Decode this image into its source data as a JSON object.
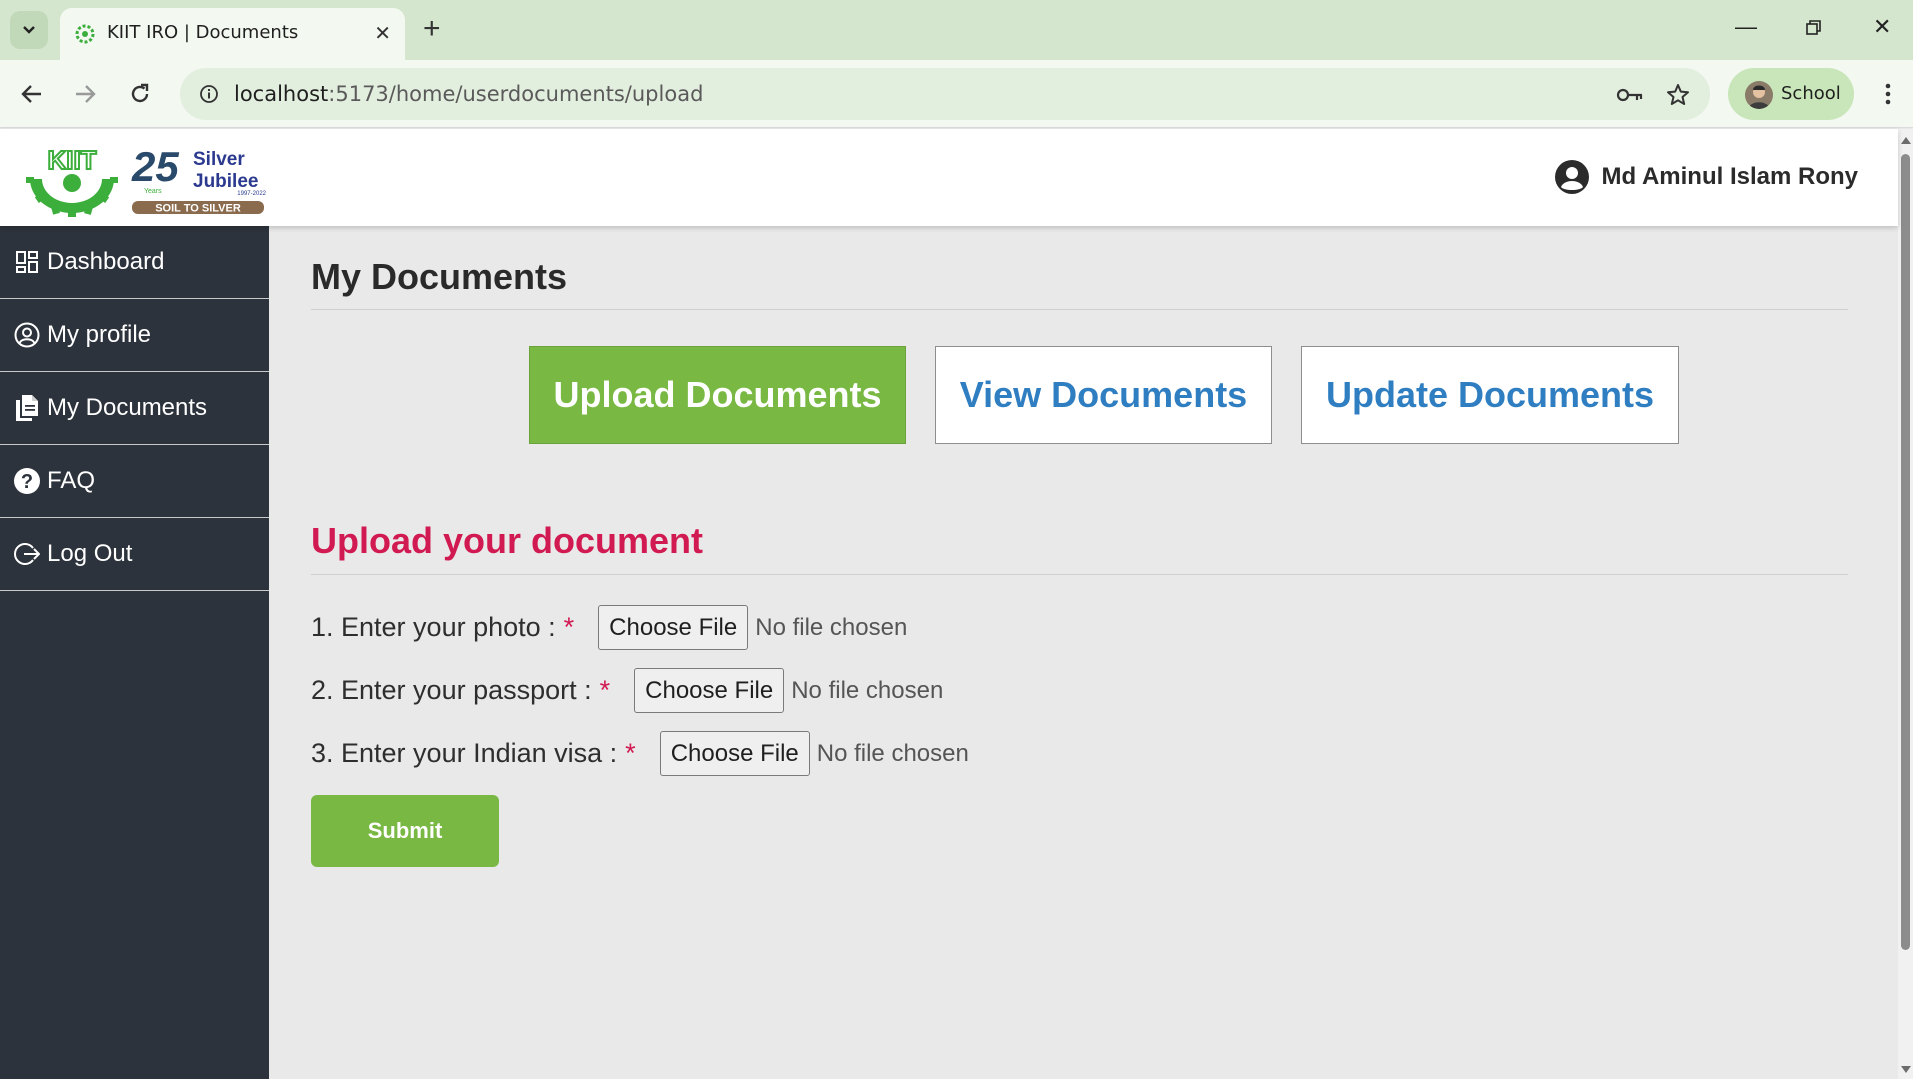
{
  "browser": {
    "tab_title": "KIIT IRO | Documents",
    "url_host": "localhost",
    "url_path": ":5173/home/userdocuments/upload",
    "profile_name": "School",
    "accent": "#d5e6cf"
  },
  "header": {
    "logo_text": "KIIT",
    "jubilee_number": "25",
    "jubilee_years": "Years",
    "jubilee_line1": "Silver",
    "jubilee_line2": "Jubilee",
    "jubilee_dates": "1997-2022",
    "jubilee_tagline": "SOIL TO SILVER",
    "user_name": "Md Aminul Islam Rony"
  },
  "sidebar": {
    "items": [
      {
        "label": "Dashboard",
        "icon": "dashboard-icon"
      },
      {
        "label": "My profile",
        "icon": "user-circle-icon"
      },
      {
        "label": "My Documents",
        "icon": "documents-icon"
      },
      {
        "label": "FAQ",
        "icon": "question-circle-icon"
      },
      {
        "label": "Log Out",
        "icon": "logout-icon"
      }
    ]
  },
  "main": {
    "page_title": "My Documents",
    "tabs": [
      {
        "label": "Upload Documents",
        "active": true
      },
      {
        "label": "View Documents",
        "active": false
      },
      {
        "label": "Update Documents",
        "active": false
      }
    ],
    "section_title": "Upload your document",
    "fields": [
      {
        "label": "1. Enter your photo :",
        "required": "*",
        "button": "Choose File",
        "status": "No file chosen"
      },
      {
        "label": "2. Enter your passport :",
        "required": "*",
        "button": "Choose File",
        "status": "No file chosen"
      },
      {
        "label": "3. Enter your Indian visa :",
        "required": "*",
        "button": "Choose File",
        "status": "No file chosen"
      }
    ],
    "submit_label": "Submit"
  },
  "colors": {
    "primary_green": "#78b843",
    "link_blue": "#2f7ec1",
    "accent_red": "#d21a52",
    "sidebar_bg": "#2d333c"
  }
}
